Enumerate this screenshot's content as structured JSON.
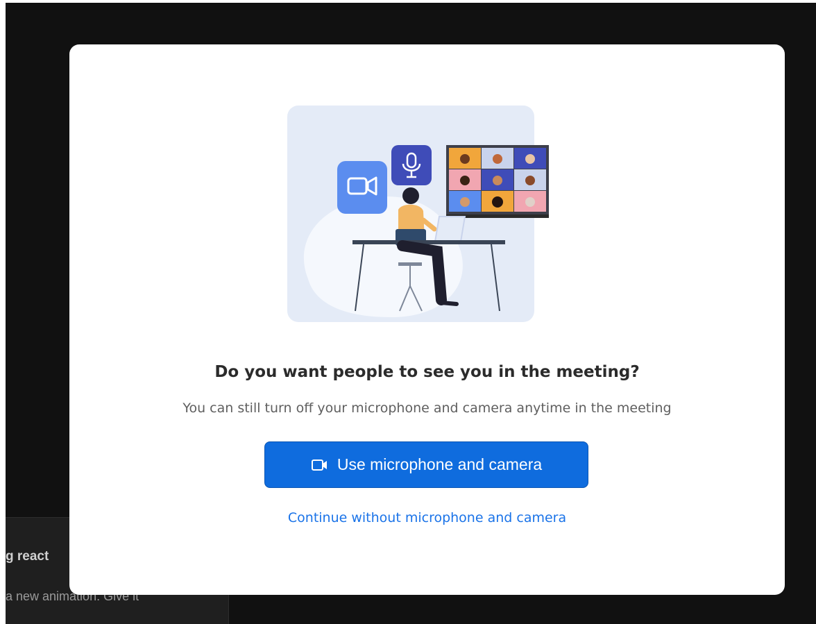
{
  "dialog": {
    "title": "Do you want people to see you in the meeting?",
    "subtitle": "You can still turn off your microphone and camera anytime in the meeting",
    "primary_button": {
      "label": "Use microphone and camera",
      "icon": "video-camera-icon"
    },
    "secondary_link": "Continue without microphone and camera",
    "illustration": {
      "icons": [
        "video-camera-icon",
        "microphone-icon"
      ]
    }
  },
  "background_toast": {
    "title": "g react",
    "body": "a new animation. Give it"
  },
  "colors": {
    "primary": "#0f6cde",
    "link": "#1a73e8",
    "backdrop": "#111111",
    "illustration_bg": "#e4ebf7",
    "camera_tile": "#5b8def",
    "mic_tile": "#3f4cb8"
  }
}
